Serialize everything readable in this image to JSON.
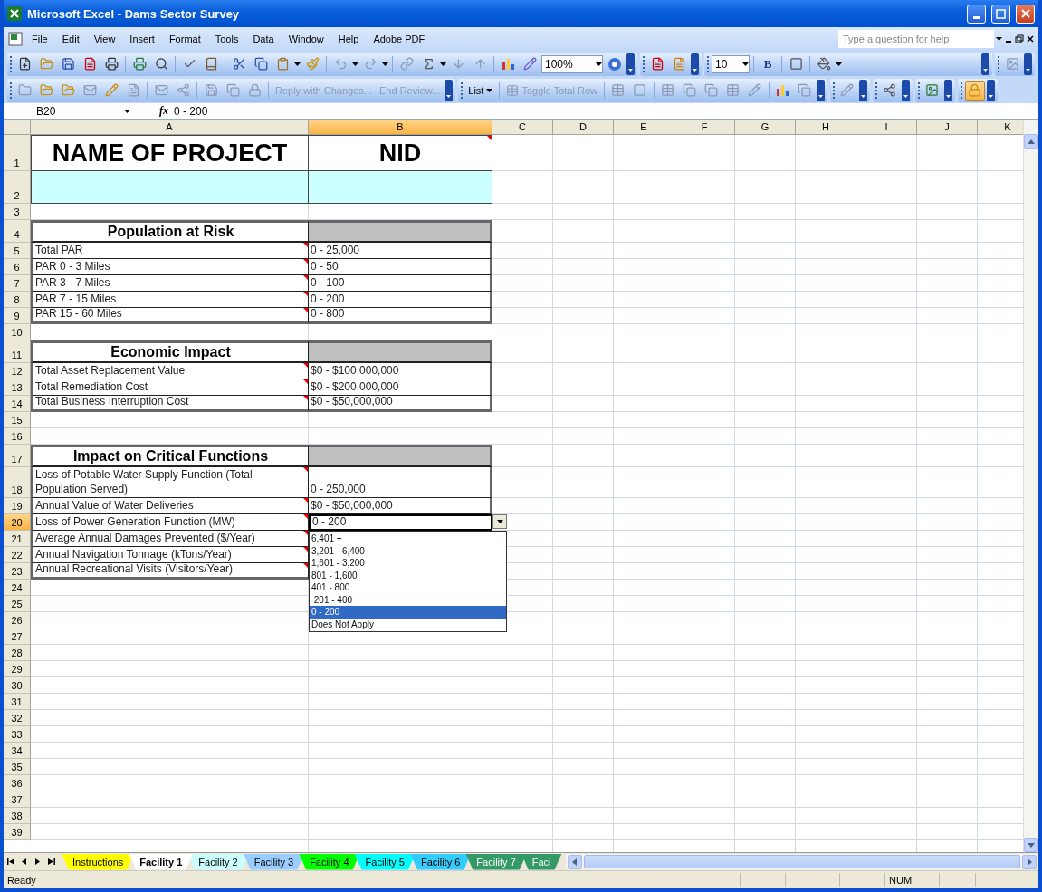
{
  "window": {
    "title": "Microsoft Excel - Dams Sector Survey"
  },
  "menu": [
    "File",
    "Edit",
    "View",
    "Insert",
    "Format",
    "Tools",
    "Data",
    "Window",
    "Help",
    "Adobe PDF"
  ],
  "help_field": {
    "placeholder": "Type a question for help"
  },
  "toolbar": {
    "zoom": "100%",
    "font_size": "10",
    "bold": "B"
  },
  "review_buttons": [
    {
      "label": "Reply with Changes...",
      "disabled": true
    },
    {
      "label": "End Review...",
      "disabled": true
    }
  ],
  "list_button": "List",
  "toggle_button": {
    "label": "Toggle Total Row",
    "disabled": true
  },
  "formula_bar": {
    "name_box": "B20",
    "function_label": "fx",
    "formula": "0 - 200"
  },
  "columns": [
    {
      "label": "A",
      "selected": false
    },
    {
      "label": "B",
      "selected": true
    },
    {
      "label": "C",
      "selected": false
    },
    {
      "label": "D",
      "selected": false
    },
    {
      "label": "E",
      "selected": false
    },
    {
      "label": "F",
      "selected": false
    },
    {
      "label": "G",
      "selected": false
    },
    {
      "label": "H",
      "selected": false
    },
    {
      "label": "I",
      "selected": false
    },
    {
      "label": "J",
      "selected": false
    },
    {
      "label": "K",
      "selected": false
    }
  ],
  "rows": [
    {
      "number": "1",
      "kind": "title",
      "selected": false,
      "a": "NAME OF PROJECT",
      "b": "NID",
      "b_comment": true
    },
    {
      "number": "2",
      "kind": "input",
      "selected": false
    },
    {
      "number": "3",
      "kind": "blank",
      "selected": false
    },
    {
      "number": "4",
      "kind": "section",
      "selected": false,
      "a": "Population at Risk"
    },
    {
      "number": "5",
      "kind": "item",
      "selected": false,
      "a": "Total PAR",
      "b": "0 - 25,000",
      "a_comment": true
    },
    {
      "number": "6",
      "kind": "item",
      "selected": false,
      "a": "PAR 0 - 3 Miles",
      "b": "0 - 50",
      "a_comment": true
    },
    {
      "number": "7",
      "kind": "item",
      "selected": false,
      "a": "PAR 3 - 7 Miles",
      "b": "0 - 100",
      "a_comment": true
    },
    {
      "number": "8",
      "kind": "item",
      "selected": false,
      "a": "PAR 7 - 15 Miles",
      "b": "0 - 200",
      "a_comment": true
    },
    {
      "number": "9",
      "kind": "item",
      "selected": false,
      "a": "PAR 15 - 60 Miles",
      "b": "0 - 800",
      "a_comment": true
    },
    {
      "number": "10",
      "kind": "blank",
      "selected": false
    },
    {
      "number": "11",
      "kind": "section",
      "selected": false,
      "a": "Economic Impact"
    },
    {
      "number": "12",
      "kind": "item",
      "selected": false,
      "a": "Total Asset Replacement Value",
      "b": "$0 - $100,000,000",
      "a_comment": true
    },
    {
      "number": "13",
      "kind": "item",
      "selected": false,
      "a": "Total Remediation Cost",
      "b": "$0 - $200,000,000",
      "a_comment": true
    },
    {
      "number": "14",
      "kind": "item",
      "selected": false,
      "a": "Total Business Interruption Cost",
      "b": "$0 - $50,000,000",
      "a_comment": true
    },
    {
      "number": "15",
      "kind": "blank",
      "selected": false
    },
    {
      "number": "16",
      "kind": "blank",
      "selected": false
    },
    {
      "number": "17",
      "kind": "section",
      "selected": false,
      "a": "Impact on Critical Functions"
    },
    {
      "number": "18",
      "kind": "item",
      "selected": false,
      "a": "Loss of Potable Water Supply Function (Total Population Served)",
      "b": "0 - 250,000",
      "a_comment": true
    },
    {
      "number": "19",
      "kind": "item",
      "selected": false,
      "a": "Annual Value of Water Deliveries",
      "b": "$0 - $50,000,000",
      "a_comment": true
    },
    {
      "number": "20",
      "kind": "item",
      "selected": true,
      "a": "Loss of Power Generation Function (MW)",
      "b": "0 - 200",
      "a_comment": true
    },
    {
      "number": "21",
      "kind": "item",
      "selected": false,
      "a": "Average Annual Damages Prevented ($/Year)",
      "a_comment": true
    },
    {
      "number": "22",
      "kind": "item",
      "selected": false,
      "a": "Annual Navigation Tonnage (kTons/Year)",
      "a_comment": true
    },
    {
      "number": "23",
      "kind": "item",
      "selected": false,
      "a": "Annual Recreational Visits (Visitors/Year)",
      "a_comment": true
    },
    {
      "number": "24",
      "kind": "blank",
      "selected": false
    },
    {
      "number": "25",
      "kind": "blank",
      "selected": false
    },
    {
      "number": "26",
      "kind": "blank",
      "selected": false
    },
    {
      "number": "27",
      "kind": "blank",
      "selected": false
    },
    {
      "number": "28",
      "kind": "blank",
      "selected": false
    },
    {
      "number": "29",
      "kind": "blank",
      "selected": false
    },
    {
      "number": "30",
      "kind": "blank",
      "selected": false
    },
    {
      "number": "31",
      "kind": "blank",
      "selected": false
    },
    {
      "number": "32",
      "kind": "blank",
      "selected": false
    },
    {
      "number": "33",
      "kind": "blank",
      "selected": false
    },
    {
      "number": "34",
      "kind": "blank",
      "selected": false
    },
    {
      "number": "35",
      "kind": "blank",
      "selected": false
    },
    {
      "number": "36",
      "kind": "blank",
      "selected": false
    },
    {
      "number": "37",
      "kind": "blank",
      "selected": false
    },
    {
      "number": "38",
      "kind": "blank",
      "selected": false
    },
    {
      "number": "39",
      "kind": "blank",
      "selected": false
    }
  ],
  "dropdown": {
    "options": [
      {
        "label": "6,401 +",
        "selected": false
      },
      {
        "label": "3,201 - 6,400",
        "selected": false
      },
      {
        "label": "1,601 - 3,200",
        "selected": false
      },
      {
        "label": "801 - 1,600",
        "selected": false
      },
      {
        "label": "401 - 800",
        "selected": false
      },
      {
        "label": " 201 - 400",
        "selected": false
      },
      {
        "label": "0 - 200",
        "selected": true
      },
      {
        "label": "Does Not Apply",
        "selected": false
      }
    ]
  },
  "sheet_tabs": [
    {
      "label": "Instructions",
      "selected": false,
      "color": "#ffff00"
    },
    {
      "label": "Facility 1",
      "selected": true,
      "color": "#ffffff"
    },
    {
      "label": "Facility 2",
      "selected": false,
      "color": "#ccffff"
    },
    {
      "label": "Facility 3",
      "selected": false,
      "color": "#99ccff"
    },
    {
      "label": "Facility 4",
      "selected": false,
      "color": "#00ff00"
    },
    {
      "label": "Facility 5",
      "selected": false,
      "color": "#00ffff"
    },
    {
      "label": "Facility 6",
      "selected": false,
      "color": "#33ccff"
    },
    {
      "label": "Facility 7",
      "selected": false,
      "color": "#339966"
    },
    {
      "label": "Faci",
      "selected": false,
      "color": "#339966"
    }
  ],
  "status_bar": {
    "status": "Ready",
    "num_lock": "NUM"
  }
}
